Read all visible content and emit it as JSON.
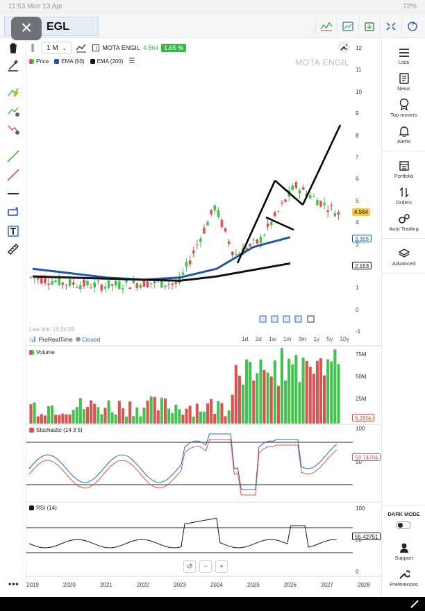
{
  "statusbar": {
    "left": "11:53 Mon 13 Apr",
    "right": "72%"
  },
  "header": {
    "ticker": "EGL"
  },
  "chart_toolbar": {
    "interval": "1 M",
    "name": "MOTA ENGIL",
    "price": "4.564",
    "change": "1.65 %"
  },
  "legend": {
    "price": "Price",
    "ema50": "EMA (50)",
    "ema200": "EMA (200)"
  },
  "watermark": "MOTA ENGIL",
  "last_tick": "Last tick: 16:34:59",
  "provider": {
    "name": "ProRealTime",
    "status": "Closed"
  },
  "ranges": [
    "1d",
    "2d",
    "1w",
    "1m",
    "3m",
    "1y",
    "5y",
    "10y"
  ],
  "price_axis": [
    "12",
    "11",
    "10",
    "9",
    "8",
    "7",
    "6",
    "5",
    "4",
    "3",
    "2",
    "1",
    "0",
    "-1"
  ],
  "price_tags": {
    "last": "4.564",
    "ema50": "3.355",
    "ema200": "2.153"
  },
  "volume": {
    "label": "Volume",
    "axis": [
      "75M",
      "50M",
      "25M"
    ],
    "last": "6,265k"
  },
  "stochastic": {
    "label": "Stochastic (14 3 5)",
    "axis": [
      "100",
      "50"
    ],
    "last": "59.74704"
  },
  "rsi": {
    "label": "RSI (14)",
    "axis": [
      "100",
      "50",
      "0"
    ],
    "last": "55.42751"
  },
  "x_axis": [
    "2019",
    "2020",
    "2021",
    "2022",
    "2023",
    "2024",
    "2025",
    "2026",
    "2027",
    "2028"
  ],
  "sidebar": {
    "lists": "Lists",
    "news": "News",
    "top_movers": "Top movers",
    "alerts": "Alerts",
    "portfolio": "Portfolio",
    "orders": "Orders",
    "auto_trading": "Auto Trading",
    "advanced": "Advanced",
    "dark_mode": "DARK MODE",
    "support": "Support",
    "preferences": "Preferences"
  },
  "colors": {
    "up": "#43c24f",
    "down": "#d9534f",
    "ema50": "#1f57a8",
    "ema200": "#111111",
    "accent_green": "#3bb54a",
    "last_price_tag": "#f7c948"
  },
  "chart_data": {
    "type": "candlestick",
    "x": [
      "2019",
      "2020",
      "2021",
      "2022",
      "2023",
      "2024",
      "2025",
      "2026"
    ],
    "series": [
      {
        "name": "EMA (50)",
        "values": [
          1.9,
          1.7,
          1.5,
          1.4,
          1.5,
          1.9,
          2.9,
          3.35
        ]
      },
      {
        "name": "EMA (200)",
        "values": [
          1.55,
          1.5,
          1.45,
          1.4,
          1.35,
          1.55,
          1.85,
          2.15
        ]
      }
    ],
    "ylim": [
      -1,
      12
    ],
    "grid": false
  }
}
